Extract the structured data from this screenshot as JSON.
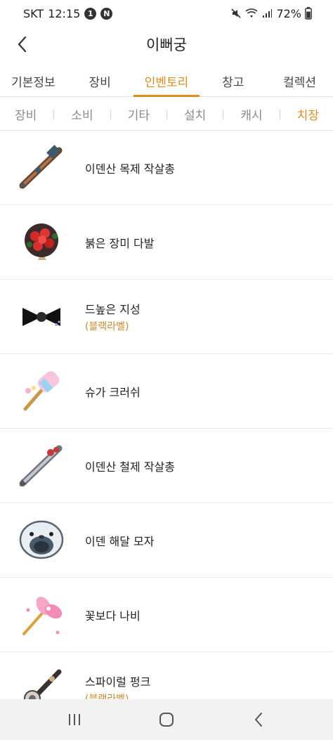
{
  "status": {
    "carrier": "SKT",
    "time": "12:15",
    "badges": [
      "1",
      "N"
    ],
    "battery": "72%"
  },
  "header": {
    "title": "이뻐궁"
  },
  "main_tabs": [
    {
      "label": "기본정보"
    },
    {
      "label": "장비"
    },
    {
      "label": "인벤토리"
    },
    {
      "label": "창고"
    },
    {
      "label": "컬렉션"
    }
  ],
  "sub_tabs": [
    {
      "label": "장비"
    },
    {
      "label": "소비"
    },
    {
      "label": "기타"
    },
    {
      "label": "설치"
    },
    {
      "label": "캐시"
    },
    {
      "label": "치장"
    }
  ],
  "items": [
    {
      "name": "이덴산 목제 작살총",
      "tag": "",
      "icon": "harpoon-gun-wood-icon"
    },
    {
      "name": "붉은 장미 다발",
      "tag": "",
      "icon": "rose-bouquet-icon"
    },
    {
      "name": "드높은 지성",
      "tag": "(블랙라벨)",
      "icon": "black-ribbon-icon"
    },
    {
      "name": "슈가 크러쉬",
      "tag": "",
      "icon": "candy-hammer-icon"
    },
    {
      "name": "이덴산 철제 작살총",
      "tag": "",
      "icon": "harpoon-gun-iron-icon"
    },
    {
      "name": "이덴 해달 모자",
      "tag": "",
      "icon": "sea-otter-hat-icon"
    },
    {
      "name": "꽃보다 나비",
      "tag": "",
      "icon": "butterfly-wand-icon"
    },
    {
      "name": "스파이럴 펑크",
      "tag": "(블랙라벨)",
      "icon": "spiral-punk-icon"
    }
  ],
  "colors": {
    "accent": "#e38a1e",
    "tag": "#c98a2a"
  }
}
